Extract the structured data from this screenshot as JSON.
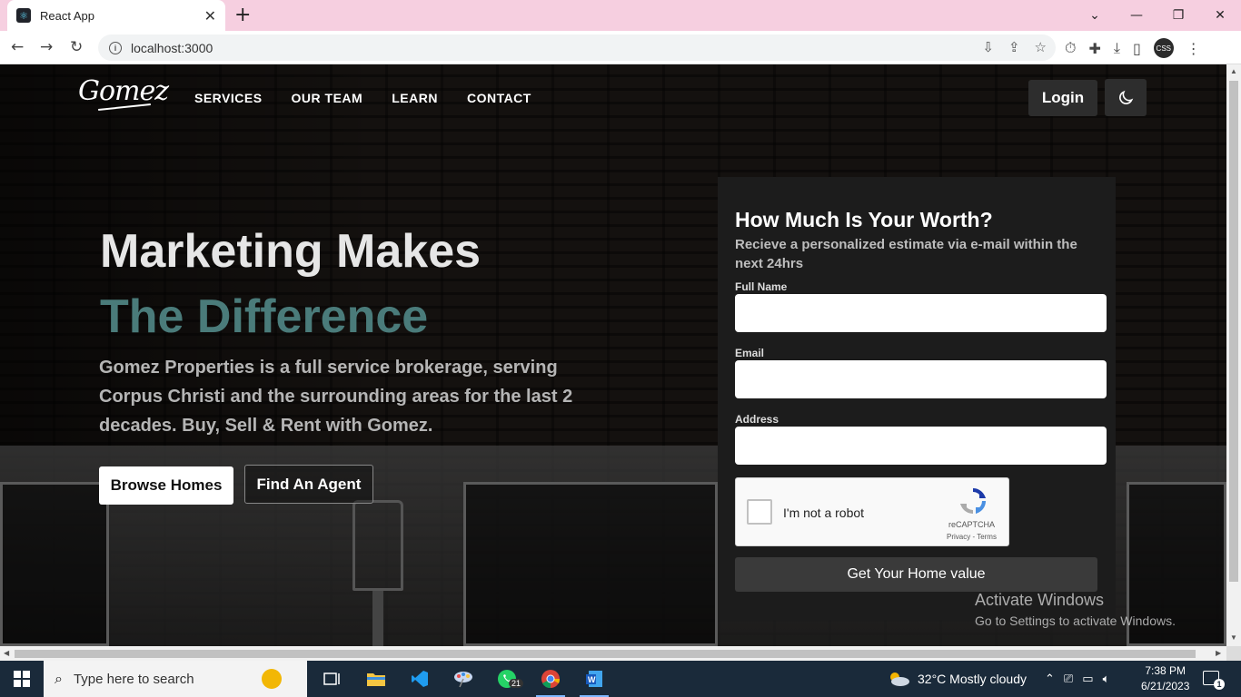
{
  "browser": {
    "tab_title": "React App",
    "url": "localhost:3000",
    "profile_initials": "CSS"
  },
  "nav": {
    "logo": "Gomez",
    "links": [
      "SERVICES",
      "OUR TEAM",
      "LEARN",
      "CONTACT"
    ],
    "login": "Login"
  },
  "hero": {
    "title_line1": "Marketing Makes",
    "title_line2": "The Difference",
    "description": "Gomez Properties is a full service brokerage, serving Corpus Christi and the surrounding areas for the last 2 decades. Buy, Sell & Rent with Gomez.",
    "browse_button": "Browse Homes",
    "agent_button": "Find An Agent"
  },
  "form": {
    "title": "How Much Is Your Worth?",
    "subtitle": "Recieve a personalized estimate via e-mail within the next 24hrs",
    "full_name_label": "Full Name",
    "email_label": "Email",
    "address_label": "Address",
    "recaptcha_label": "I'm not a robot",
    "recaptcha_brand": "reCAPTCHA",
    "recaptcha_terms": "Privacy - Terms",
    "submit": "Get Your Home value"
  },
  "watermark": {
    "line1": "Activate Windows",
    "line2": "Go to Settings to activate Windows."
  },
  "taskbar": {
    "search_placeholder": "Type here to search",
    "whatsapp_badge": "21",
    "weather": "32°C  Mostly cloudy",
    "time": "7:38 PM",
    "date": "6/21/2023",
    "notification_count": "1"
  },
  "colors": {
    "accent_teal": "#4a7b7a",
    "pink_tabbar": "#f6cfe0",
    "card_bg": "#1c1c1c"
  }
}
